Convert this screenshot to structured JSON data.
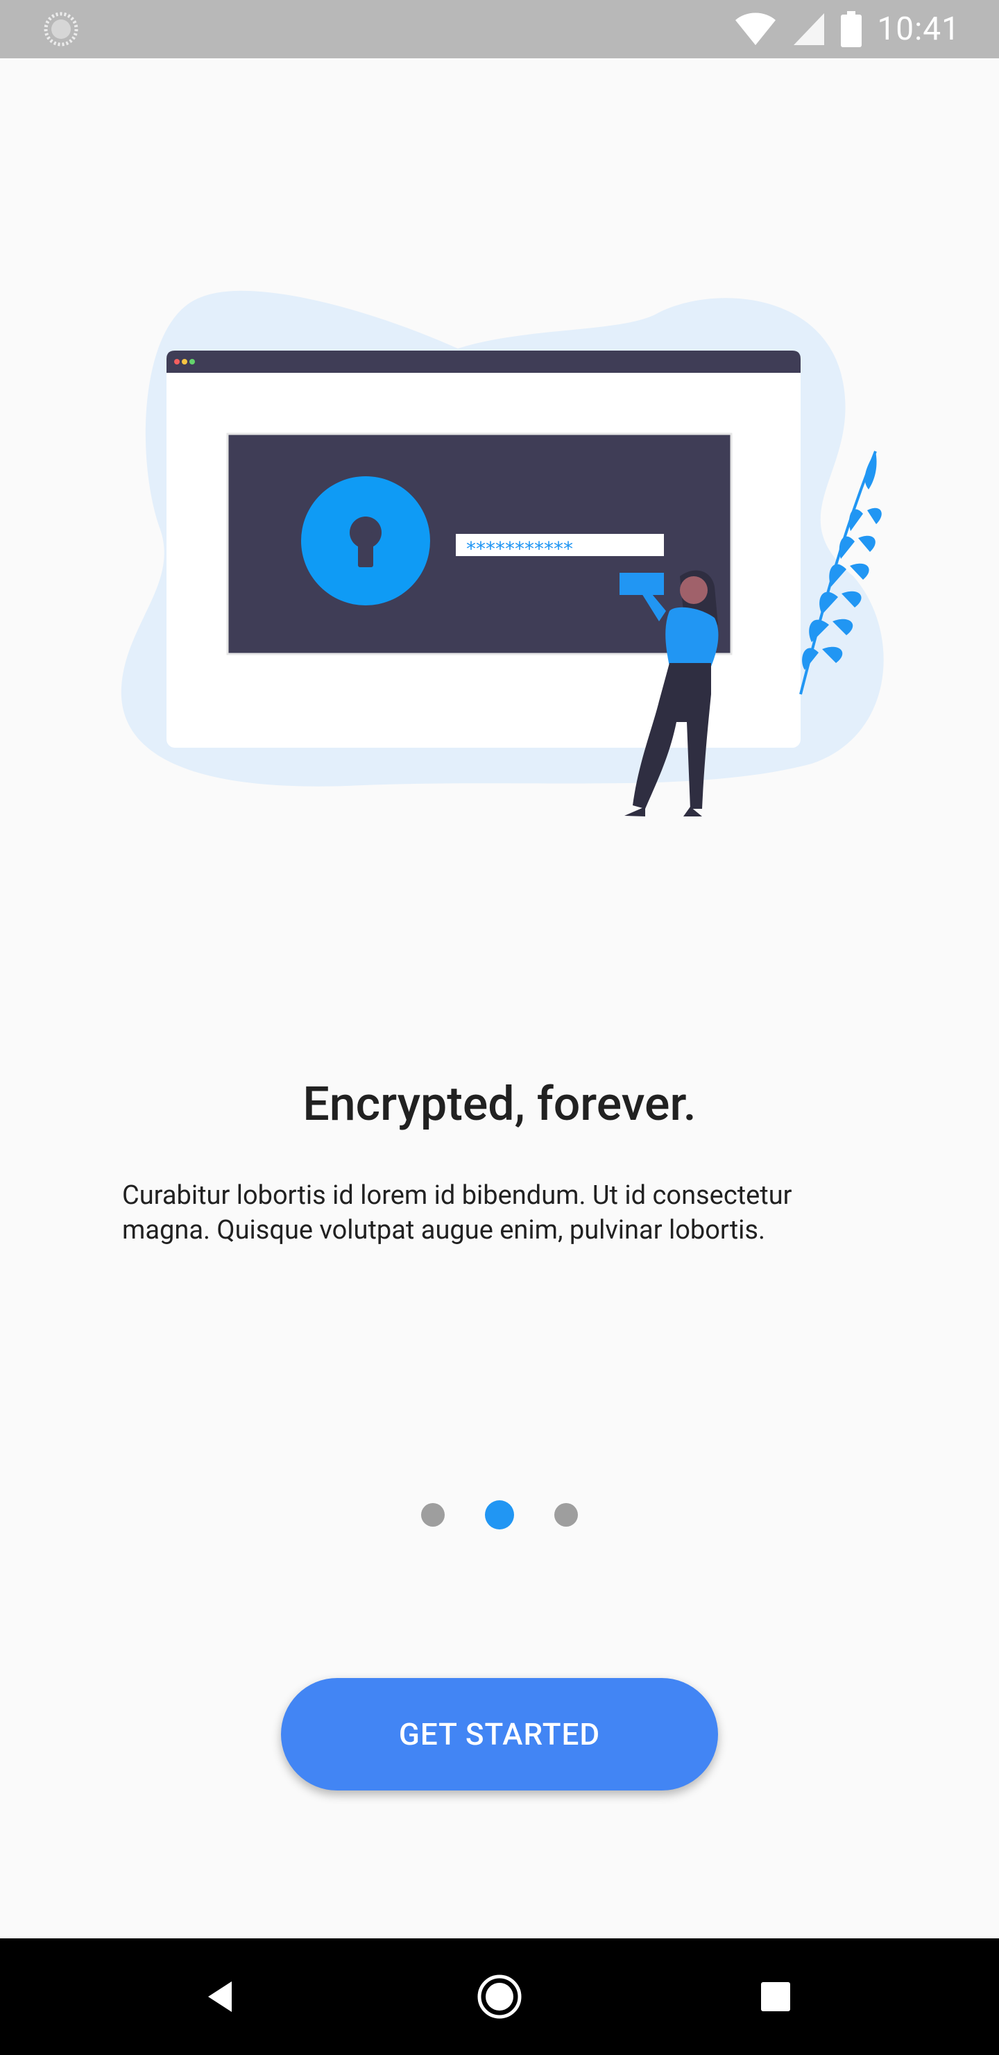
{
  "status_bar": {
    "time": "10:41",
    "left_icon": "loading-circle-icon",
    "icons": [
      "wifi-icon",
      "cellular-signal-icon",
      "battery-icon"
    ]
  },
  "illustration": {
    "password_mask": "***********",
    "colors": {
      "accent": "#2196f3",
      "dark": "#3f3d56",
      "blob": "#e3effb"
    }
  },
  "onboarding": {
    "title": "Encrypted, forever.",
    "body": "Curabitur lobortis id lorem id bibendum. Ut id consectetur magna. Quisque volutpat augue enim, pulvinar lobortis.",
    "page_count": 3,
    "current_page": 2
  },
  "cta": {
    "label": "GET STARTED",
    "color": "#4285f4"
  },
  "nav_bar": {
    "icons": [
      "back-icon",
      "home-icon",
      "recents-icon"
    ]
  }
}
